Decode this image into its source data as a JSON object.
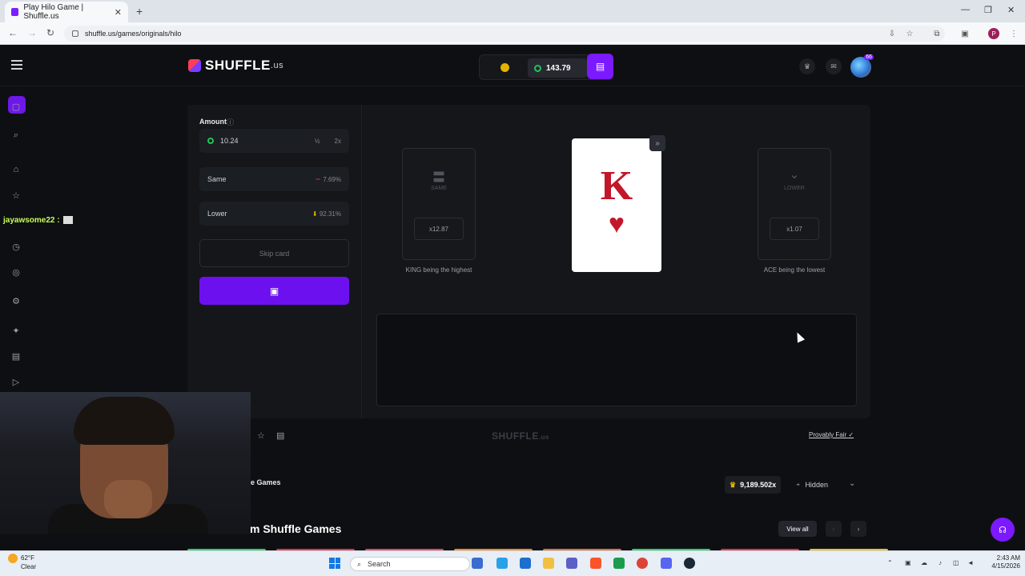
{
  "browser": {
    "tab_title": "Play Hilo Game | Shuffle.us",
    "url": "shuffle.us/games/originals/hilo",
    "profile_initial": "P"
  },
  "header": {
    "logo_text": "SHUFFLE",
    "logo_suffix": ".us",
    "balance": "143.79",
    "avatar_level": "66"
  },
  "bet": {
    "amount_label": "Amount",
    "amount_value": "10.24",
    "half_label": "½",
    "double_label": "2x",
    "same_label": "Same",
    "same_pct": "7.69%",
    "lower_label": "Lower",
    "lower_pct": "92.31%",
    "skip_label": "Skip card"
  },
  "game": {
    "left_slot_label": "SAME",
    "left_multiplier": "x12.87",
    "left_caption": "KING being the highest",
    "right_slot_label": "LOWER",
    "right_multiplier": "x1.07",
    "right_caption": "ACE being the lowest",
    "card_rank": "K",
    "card_suit": "♥",
    "watermark": "SHUFFLE",
    "watermark_suffix": ".us",
    "provably_fair": "Provably Fair"
  },
  "leaderboard": {
    "tab_label": "e Games",
    "max_multiplier": "9,189.502x",
    "visibility": "Hidden"
  },
  "section": {
    "title": "m Shuffle Games",
    "view_all": "View all"
  },
  "overlay": {
    "chat_user": "jayawsome22 :"
  },
  "taskbar": {
    "temp": "62°F",
    "condition": "Clear",
    "search_placeholder": "Search",
    "time": "2:43 AM",
    "date": "4/15/2026"
  },
  "colors": {
    "accent": "#7b19ff",
    "card_red": "#c4162a",
    "balance_green": "#20c35a"
  }
}
